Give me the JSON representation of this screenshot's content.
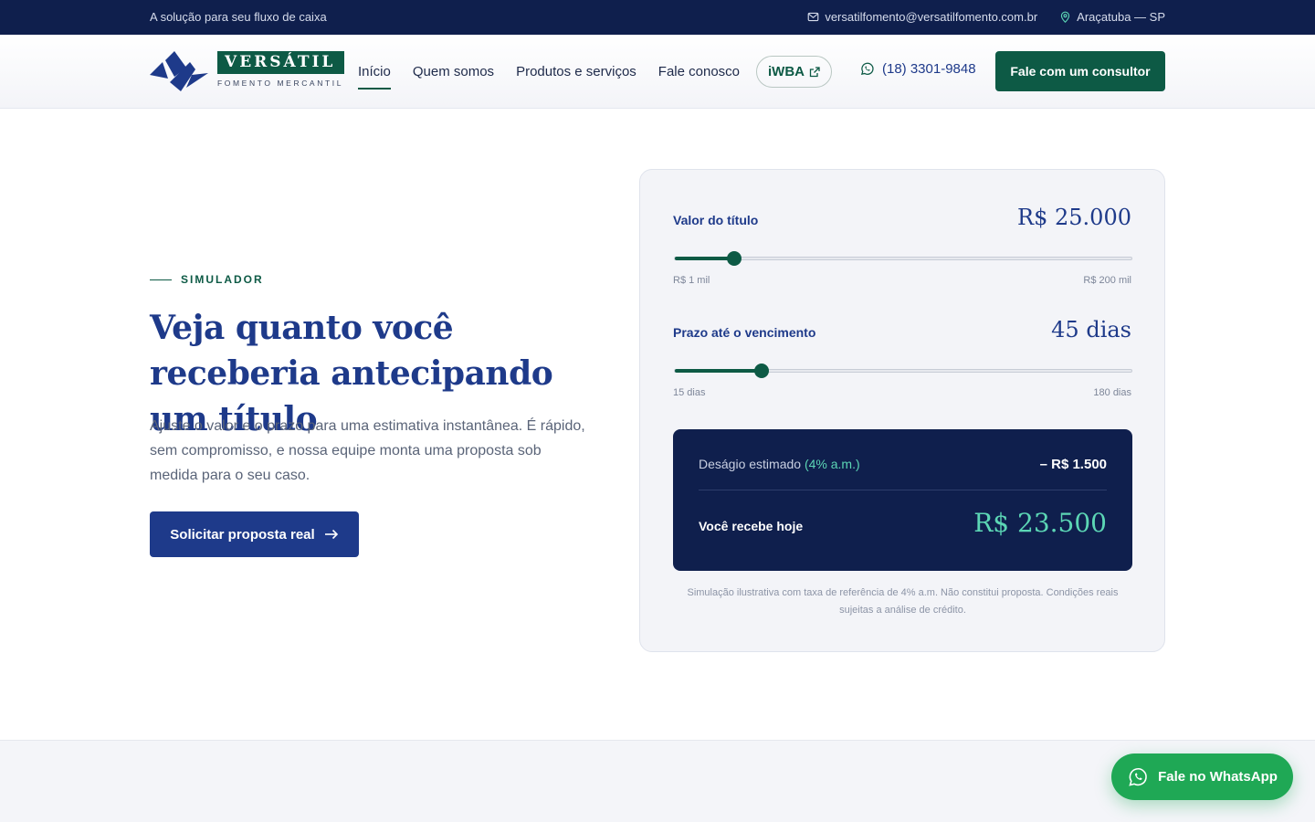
{
  "topbar": {
    "tagline": "A solução para seu fluxo de caixa",
    "email": "versatilfomento@versatilfomento.com.br",
    "location": "Araçatuba — SP"
  },
  "header": {
    "logo_word": "VERSÁTIL",
    "logo_sub": "FOMENTO MERCANTIL",
    "nav": [
      "Início",
      "Quem somos",
      "Produtos e serviços",
      "Fale conosco"
    ],
    "iwba_label": "iWBA",
    "phone": "(18) 3301-9848",
    "cta_label": "Fale com um consultor"
  },
  "hero": {
    "eyebrow": "SIMULADOR",
    "headline": "Veja quanto você receberia antecipando um título",
    "lead": "Ajuste o valor e o prazo para uma estimativa instantânea. É rápido, sem compromisso, e nossa equipe monta uma proposta sob medida para o seu caso.",
    "button_label": "Solicitar proposta real"
  },
  "simulator": {
    "value": {
      "label": "Valor do título",
      "display": "R$ 25.000",
      "min_label": "R$ 1 mil",
      "max_label": "R$ 200 mil",
      "fraction": 0.13
    },
    "term": {
      "label": "Prazo até o vencimento",
      "display": "45 dias",
      "min_label": "15 dias",
      "max_label": "180 dias",
      "fraction": 0.19
    },
    "result": {
      "discount_label": "Deságio estimado",
      "discount_rate": "(4% a.m.)",
      "discount_value": "– R$ 1.500",
      "receive_label": "Você recebe hoje",
      "receive_value": "R$ 23.500"
    },
    "disclaimer": "Simulação ilustrativa com taxa de referência de 4% a.m. Não constitui proposta. Condições reais sujeitas a análise de crédito."
  },
  "whatsapp": {
    "label": "Fale no WhatsApp"
  },
  "colors": {
    "navy": "#0f1f4d",
    "brand_blue": "#1e3a8a",
    "brand_green": "#0d5a45",
    "accent_teal": "#5cd6b5",
    "whatsapp_green": "#1fa855"
  }
}
